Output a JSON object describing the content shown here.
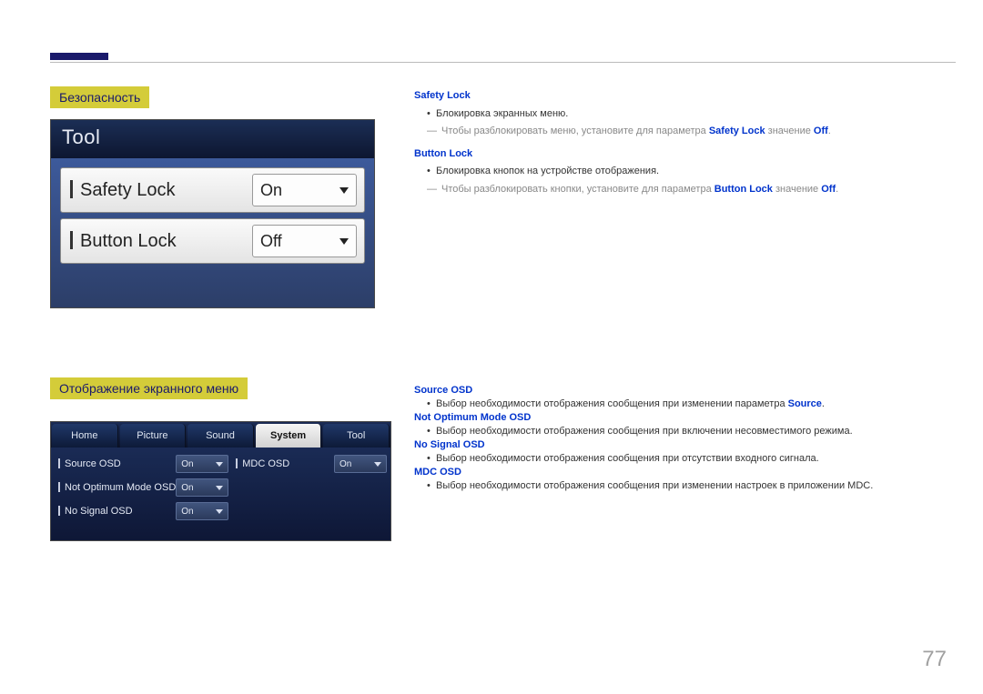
{
  "page_number": "77",
  "section1": {
    "title": "Безопасность",
    "tool_header": "Tool",
    "rows": [
      {
        "label": "Safety Lock",
        "value": "On"
      },
      {
        "label": "Button Lock",
        "value": "Off"
      }
    ],
    "desc": {
      "safety_lock_hd": "Safety Lock",
      "safety_lock_bul": "Блокировка экранных меню.",
      "safety_lock_note_pre": "Чтобы разблокировать меню, установите для параметра ",
      "safety_lock_note_em1": "Safety Lock",
      "safety_lock_note_mid": " значение ",
      "safety_lock_note_em2": "Off",
      "safety_lock_note_suf": ".",
      "button_lock_hd": "Button Lock",
      "button_lock_bul": "Блокировка кнопок на устройстве отображения.",
      "button_lock_note_pre": "Чтобы разблокировать кнопки, установите для параметра ",
      "button_lock_note_em1": "Button Lock",
      "button_lock_note_mid": " значение ",
      "button_lock_note_em2": "Off",
      "button_lock_note_suf": "."
    }
  },
  "section2": {
    "title": "Отображение экранного меню",
    "tabs": [
      "Home",
      "Picture",
      "Sound",
      "System",
      "Tool"
    ],
    "active_tab_index": 3,
    "left_rows": [
      {
        "label": "Source OSD",
        "value": "On"
      },
      {
        "label": "Not Optimum Mode OSD",
        "value": "On"
      },
      {
        "label": "No Signal OSD",
        "value": "On"
      }
    ],
    "right_rows": [
      {
        "label": "MDC OSD",
        "value": "On"
      }
    ],
    "desc": {
      "source_hd": "Source OSD",
      "source_bul_pre": "Выбор необходимости отображения сообщения при изменении параметра ",
      "source_bul_em": "Source",
      "source_bul_suf": ".",
      "notopt_hd": "Not Optimum Mode OSD",
      "notopt_bul": "Выбор необходимости отображения сообщения при включении несовместимого режима.",
      "nosignal_hd": "No Signal OSD",
      "nosignal_bul": "Выбор необходимости отображения сообщения при отсутствии входного сигнала.",
      "mdc_hd": "MDC OSD",
      "mdc_bul": "Выбор необходимости отображения сообщения при изменении настроек в приложении MDC."
    }
  }
}
